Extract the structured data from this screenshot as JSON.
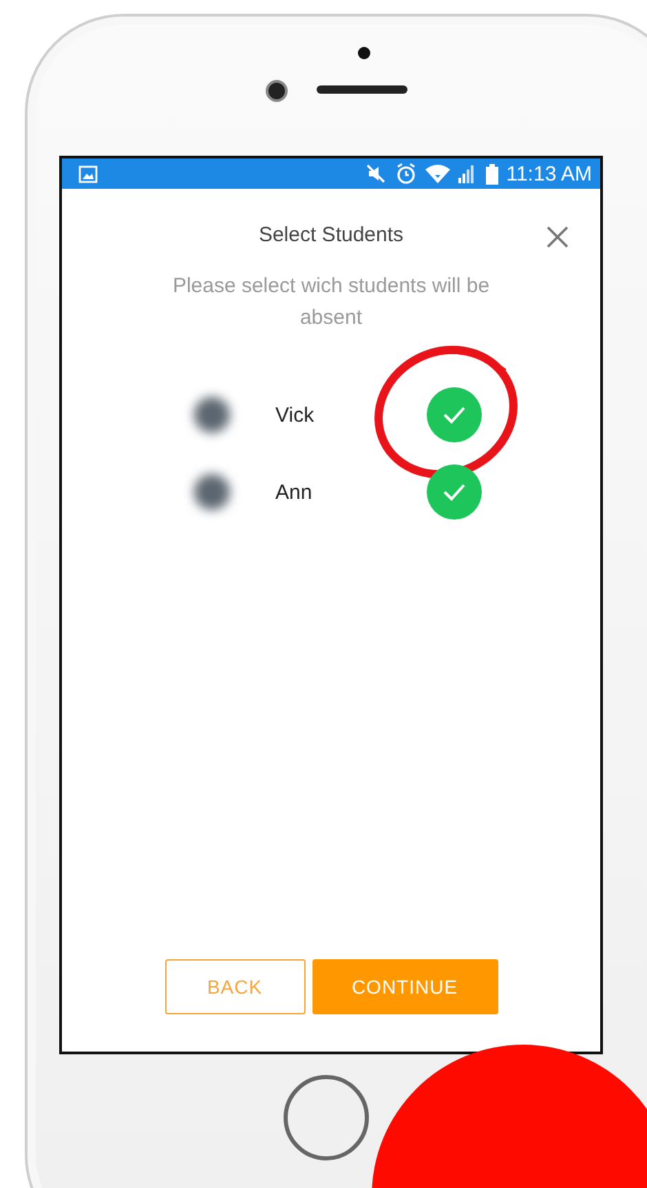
{
  "status_bar": {
    "time": "11:13 AM"
  },
  "dialog": {
    "title": "Select Students",
    "subtitle": "Please select wich students will be absent"
  },
  "students": [
    {
      "name": "Vick",
      "selected": true,
      "highlighted": true
    },
    {
      "name": "Ann",
      "selected": true,
      "highlighted": false
    }
  ],
  "buttons": [
    {
      "label": "BACK",
      "kind": "outline"
    },
    {
      "label": "CONTINUE",
      "kind": "filled"
    }
  ]
}
